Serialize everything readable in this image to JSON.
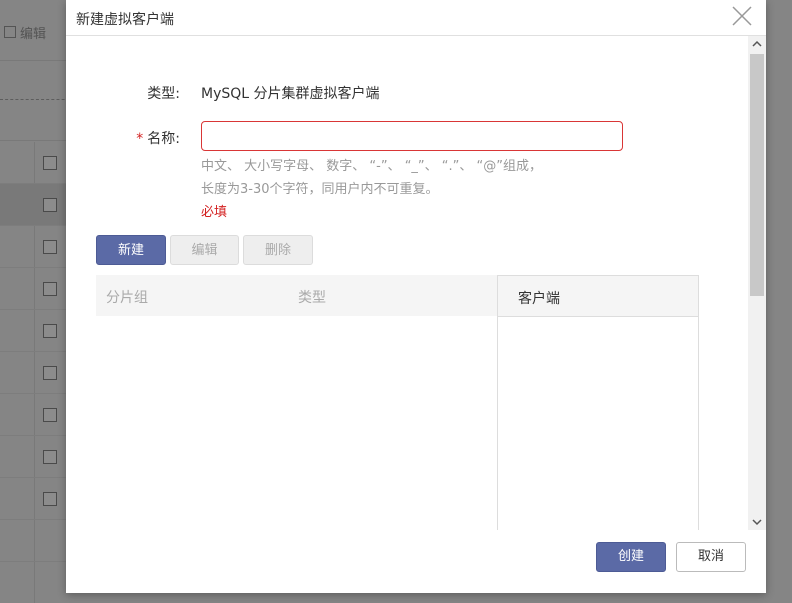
{
  "background": {
    "toolbar_edit_label": "编辑"
  },
  "dialog": {
    "title": "新建虚拟客户端",
    "close_icon": "close-icon"
  },
  "form": {
    "type_label": "类型:",
    "type_value": "MySQL 分片集群虚拟客户端",
    "required_mark": "*",
    "name_label": "名称:",
    "name_value": "",
    "hint_line1": "中文、 大小写字母、 数字、 “-”、 “_”、 “.”、 “@”组成，",
    "hint_line2": "长度为3-30个字符，同用户内不可重复。",
    "error_text": "必填"
  },
  "toolbar": {
    "new_label": "新建",
    "edit_label": "编辑",
    "delete_label": "删除"
  },
  "table_left": {
    "columns": [
      "分片组",
      "类型"
    ]
  },
  "table_right": {
    "columns": [
      "客户端"
    ]
  },
  "footer": {
    "create_label": "创建",
    "cancel_label": "取消"
  },
  "colors": {
    "primary": "#5b6aa6",
    "error": "#d32020"
  }
}
